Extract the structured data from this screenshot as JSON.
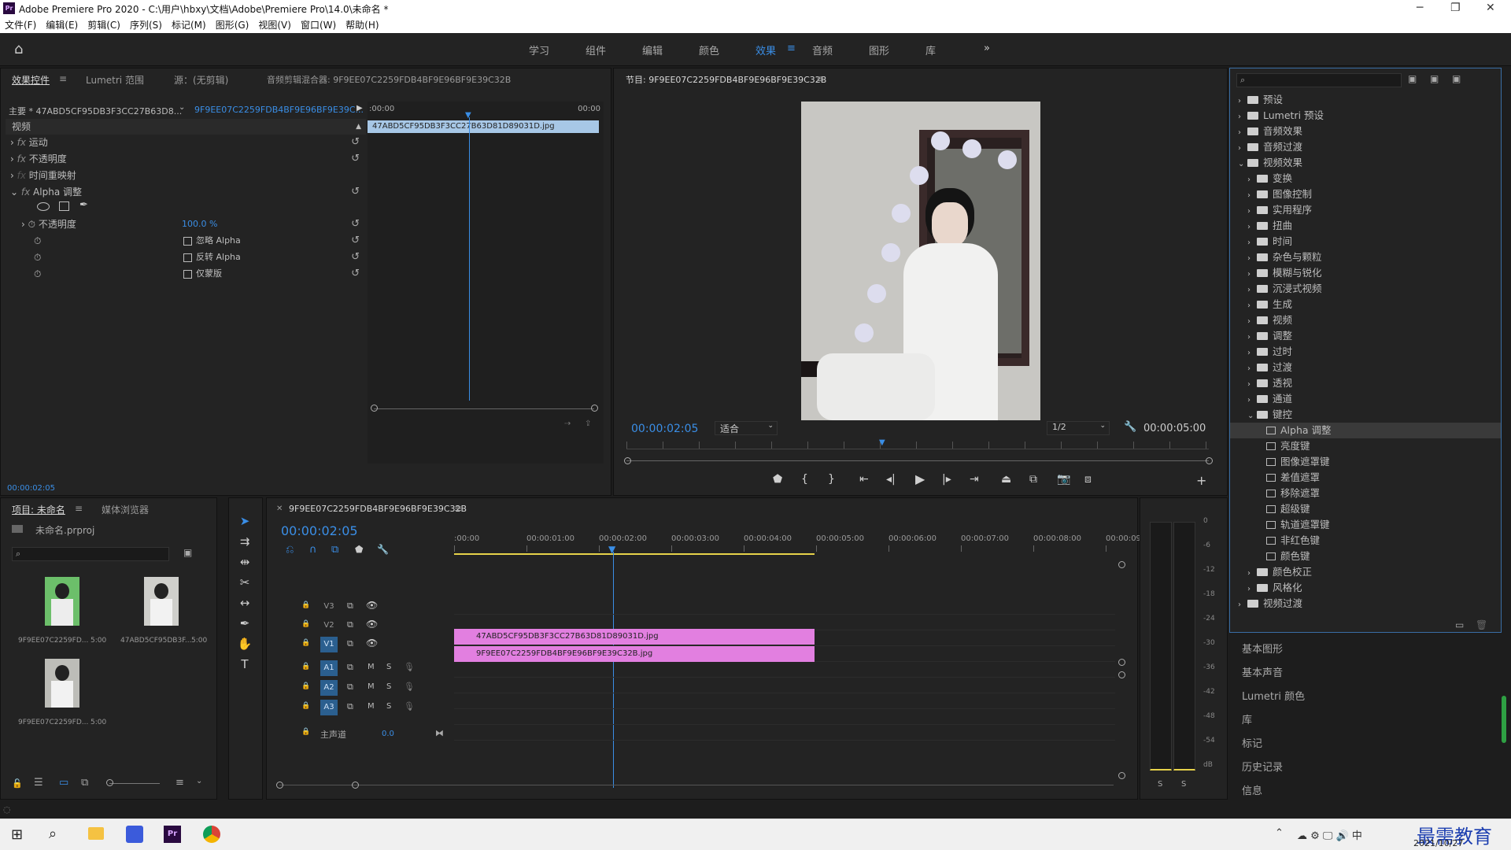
{
  "titlebar": {
    "app_badge": "Pr",
    "title": "Adobe Premiere Pro 2020 - C:\\用户\\hbxy\\文档\\Adobe\\Premiere Pro\\14.0\\未命名 *",
    "min": "─",
    "max": "❐",
    "close": "✕"
  },
  "menu": [
    "文件(F)",
    "编辑(E)",
    "剪辑(C)",
    "序列(S)",
    "标记(M)",
    "图形(G)",
    "视图(V)",
    "窗口(W)",
    "帮助(H)"
  ],
  "workspaces": [
    "学习",
    "组件",
    "编辑",
    "颜色",
    "效果",
    "音频",
    "图形",
    "库"
  ],
  "active_workspace": "效果",
  "effect_controls": {
    "tabs": [
      "效果控件",
      "Lumetri 范围",
      "源：(无剪辑)",
      "音频剪辑混合器: 9F9EE07C2259FDB4BF9E96BF9E39C32B"
    ],
    "master_label": "主要 * 47ABD5CF95DB3F3CC27B63D8...",
    "sequence_label": "9F9EE07C2259FDB4BF9E96BF9E39C...",
    "time_start": ":00:00",
    "time_end": "00:00",
    "clip_name": "47ABD5CF95DB3F3CC27B63D81D89031D.jpg",
    "section": "视频",
    "rows": [
      {
        "label": "运动",
        "fx": true
      },
      {
        "label": "不透明度",
        "fx": true
      },
      {
        "label": "时间重映射",
        "fx": false
      },
      {
        "label": "Alpha 调整",
        "fx": true
      }
    ],
    "opacity_label": "不透明度",
    "opacity_value": "100.0 %",
    "checkbox_items": [
      "忽略 Alpha",
      "反转 Alpha",
      "仅蒙版"
    ],
    "footer_time": "00:00:02:05"
  },
  "program": {
    "title": "节目: 9F9EE07C2259FDB4BF9E96BF9E39C32B",
    "timecode": "00:00:02:05",
    "fit": "适合",
    "resolution": "1/2",
    "duration": "00:00:05:00",
    "playhead_fraction": 0.44
  },
  "effects_panel": {
    "search_placeholder": "",
    "items": [
      {
        "label": "预设",
        "indent": 0,
        "type": "folder"
      },
      {
        "label": "Lumetri 预设",
        "indent": 0,
        "type": "folder"
      },
      {
        "label": "音频效果",
        "indent": 0,
        "type": "folder"
      },
      {
        "label": "音频过渡",
        "indent": 0,
        "type": "folder"
      },
      {
        "label": "视频效果",
        "indent": 0,
        "type": "folder",
        "open": true
      },
      {
        "label": "变换",
        "indent": 1,
        "type": "folder"
      },
      {
        "label": "图像控制",
        "indent": 1,
        "type": "folder"
      },
      {
        "label": "实用程序",
        "indent": 1,
        "type": "folder"
      },
      {
        "label": "扭曲",
        "indent": 1,
        "type": "folder"
      },
      {
        "label": "时间",
        "indent": 1,
        "type": "folder"
      },
      {
        "label": "杂色与颗粒",
        "indent": 1,
        "type": "folder"
      },
      {
        "label": "模糊与锐化",
        "indent": 1,
        "type": "folder"
      },
      {
        "label": "沉浸式视频",
        "indent": 1,
        "type": "folder"
      },
      {
        "label": "生成",
        "indent": 1,
        "type": "folder"
      },
      {
        "label": "视频",
        "indent": 1,
        "type": "folder"
      },
      {
        "label": "调整",
        "indent": 1,
        "type": "folder"
      },
      {
        "label": "过时",
        "indent": 1,
        "type": "folder"
      },
      {
        "label": "过渡",
        "indent": 1,
        "type": "folder"
      },
      {
        "label": "透视",
        "indent": 1,
        "type": "folder"
      },
      {
        "label": "通道",
        "indent": 1,
        "type": "folder"
      },
      {
        "label": "键控",
        "indent": 1,
        "type": "folder",
        "open": true
      },
      {
        "label": "Alpha 调整",
        "indent": 2,
        "type": "effect",
        "selected": true
      },
      {
        "label": "亮度键",
        "indent": 2,
        "type": "effect"
      },
      {
        "label": "图像遮罩键",
        "indent": 2,
        "type": "effect"
      },
      {
        "label": "差值遮罩",
        "indent": 2,
        "type": "effect"
      },
      {
        "label": "移除遮罩",
        "indent": 2,
        "type": "effect"
      },
      {
        "label": "超级键",
        "indent": 2,
        "type": "effect"
      },
      {
        "label": "轨道遮罩键",
        "indent": 2,
        "type": "effect"
      },
      {
        "label": "非红色键",
        "indent": 2,
        "type": "effect"
      },
      {
        "label": "颜色键",
        "indent": 2,
        "type": "effect"
      },
      {
        "label": "颜色校正",
        "indent": 1,
        "type": "folder"
      },
      {
        "label": "风格化",
        "indent": 1,
        "type": "folder"
      },
      {
        "label": "视频过渡",
        "indent": 0,
        "type": "folder"
      }
    ],
    "collapsed_panels": [
      "基本图形",
      "基本声音",
      "Lumetri 颜色",
      "库",
      "标记",
      "历史记录",
      "信息"
    ]
  },
  "project": {
    "tabs": [
      "项目: 未命名",
      "媒体浏览器"
    ],
    "file": "未命名.prproj",
    "items": [
      {
        "name": "9F9EE07C2259FD...",
        "dur": "5:00"
      },
      {
        "name": "47ABD5CF95DB3F...",
        "dur": "5:00"
      },
      {
        "name": "9F9EE07C2259FD...",
        "dur": "5:00"
      }
    ]
  },
  "timeline": {
    "tab": "9F9EE07C2259FDB4BF9E96BF9E39C32B",
    "timecode": "00:00:02:05",
    "ruler": [
      ":00:00",
      "00:00:01:00",
      "00:00:02:00",
      "00:00:03:00",
      "00:00:04:00",
      "00:00:05:00",
      "00:00:06:00",
      "00:00:07:00",
      "00:00:08:00",
      "00:00:09:"
    ],
    "tracks": [
      "V3",
      "V2",
      "V1",
      "A1",
      "A2",
      "A3"
    ],
    "master": "主声道",
    "master_val": "0.0",
    "clip_v2": "47ABD5CF95DB3F3CC27B63D81D89031D.jpg",
    "clip_v1": "9F9EE07C2259FDB4BF9E96BF9E39C32B.jpg",
    "mute": "M",
    "solo": "S"
  },
  "meter": {
    "scale": [
      "0",
      "-6",
      "-12",
      "-18",
      "-24",
      "-30",
      "-36",
      "-42",
      "-48",
      "-54",
      "dB"
    ],
    "s1": "S",
    "s2": "S"
  },
  "taskbar": {
    "time": "",
    "date": "2021/10/27",
    "watermark": "最需教育"
  }
}
